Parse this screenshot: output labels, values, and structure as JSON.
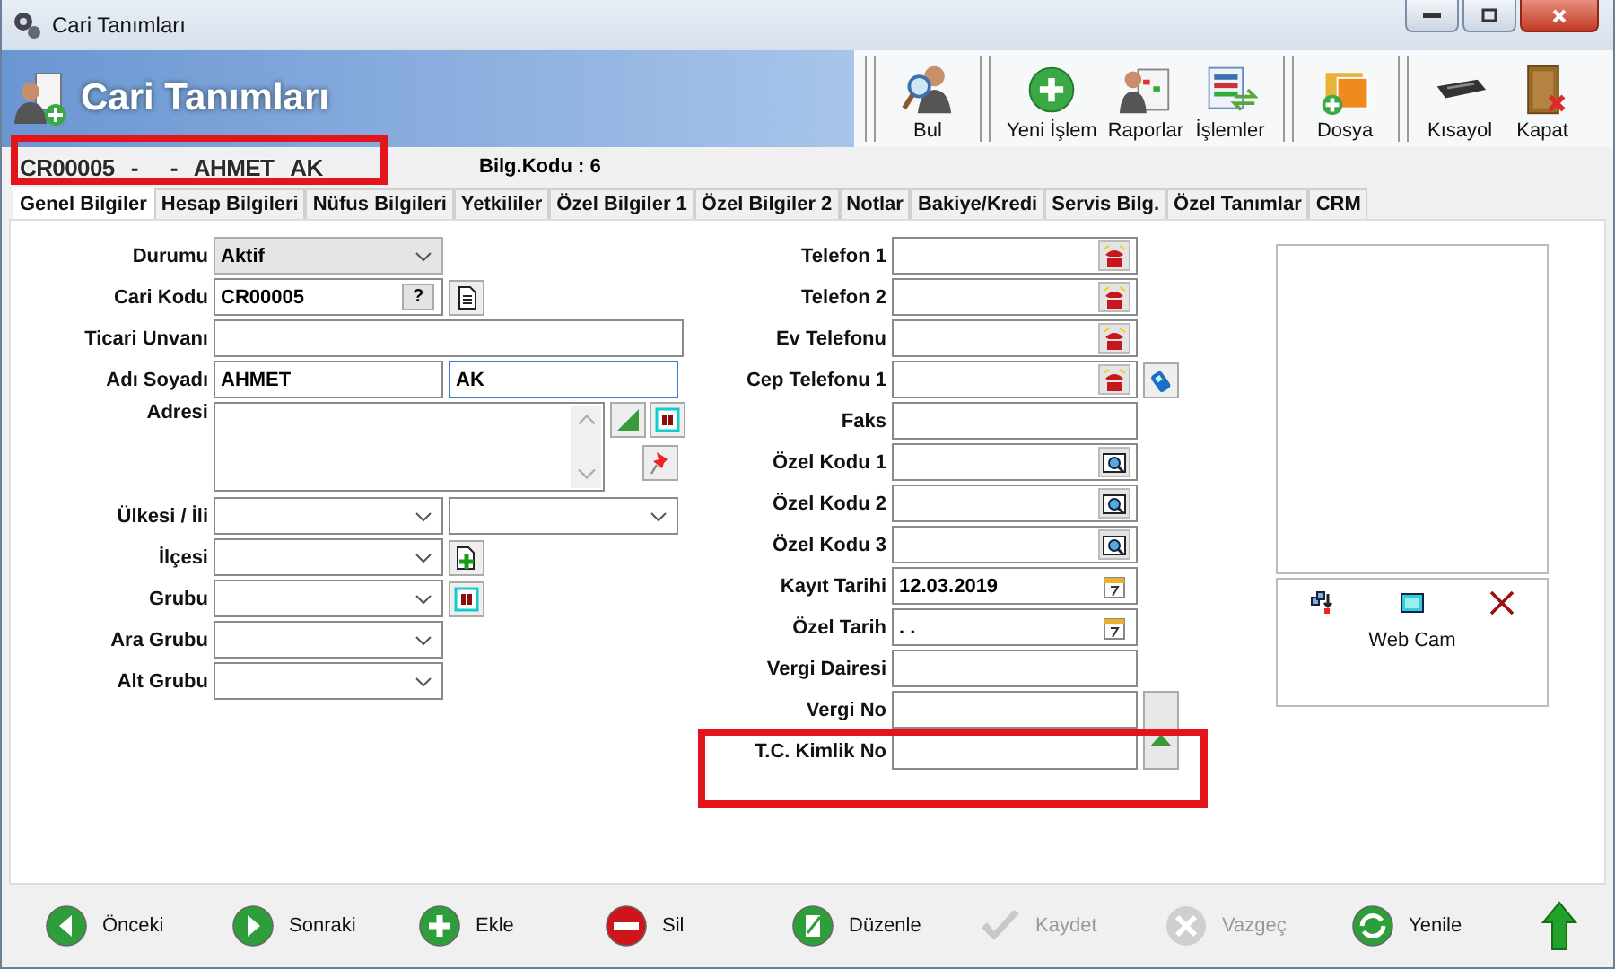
{
  "window": {
    "title": "Cari Tanımları"
  },
  "header": {
    "title": "Cari Tanımları"
  },
  "toolbar": [
    {
      "label": "Bul",
      "kind": "find"
    },
    {
      "label": "Yeni İşlem",
      "kind": "new"
    },
    {
      "label": "Raporlar",
      "kind": "reports"
    },
    {
      "label": "İşlemler",
      "kind": "operations"
    },
    {
      "label": "Dosya",
      "kind": "file"
    },
    {
      "label": "Kısayol",
      "kind": "shortcut"
    },
    {
      "label": "Kapat",
      "kind": "close"
    }
  ],
  "record_summary": [
    "CR00005",
    "-",
    "-",
    "AHMET",
    "AK"
  ],
  "bilg_kodu": "Bilg.Kodu : 6",
  "tabs": [
    {
      "label": "Genel Bilgiler",
      "selected": true
    },
    {
      "label": "Hesap Bilgileri",
      "selected": false
    },
    {
      "label": "Nüfus Bilgileri",
      "selected": false
    },
    {
      "label": "Yetkililer",
      "selected": false
    },
    {
      "label": "Özel Bilgiler 1",
      "selected": false
    },
    {
      "label": "Özel Bilgiler 2",
      "selected": false
    },
    {
      "label": "Notlar",
      "selected": false
    },
    {
      "label": "Bakiye/Kredi",
      "selected": false
    },
    {
      "label": "Servis Bilg.",
      "selected": false
    },
    {
      "label": "Özel Tanımlar",
      "selected": false
    },
    {
      "label": "CRM",
      "selected": false
    }
  ],
  "left_fields": [
    {
      "label": "Durumu",
      "kind": "status",
      "value": "Aktif"
    },
    {
      "label": "Cari Kodu",
      "kind": "lookup",
      "value": "CR00005",
      "button": "?"
    },
    {
      "label": "Ticari Unvanı",
      "kind": "text"
    },
    {
      "label": "Adı Soyadı",
      "kind": "pair",
      "values": [
        {
          "value": "AHMET",
          "focused": false
        },
        {
          "value": "AK",
          "focused": true
        }
      ]
    },
    {
      "label": "Adresi",
      "kind": "memo"
    },
    {
      "label": "Ülkesi / İli",
      "kind": "select_pair"
    },
    {
      "label": "İlçesi",
      "kind": "select_add"
    },
    {
      "label": "Grubu",
      "kind": "select_stop"
    },
    {
      "label": "Ara Grubu",
      "kind": "select"
    },
    {
      "label": "Alt Grubu",
      "kind": "select"
    }
  ],
  "middle_fields": [
    {
      "label": "Telefon 1",
      "kind": "phone"
    },
    {
      "label": "Telefon 2",
      "kind": "phone"
    },
    {
      "label": "Ev Telefonu",
      "kind": "phone"
    },
    {
      "label": "Cep Telefonu 1",
      "kind": "mobile"
    },
    {
      "label": "Faks",
      "kind": "text"
    },
    {
      "label": "Özel Kodu 1",
      "kind": "code"
    },
    {
      "label": "Özel Kodu 2",
      "kind": "code"
    },
    {
      "label": "Özel Kodu 3",
      "kind": "code"
    },
    {
      "label": "Kayıt Tarihi",
      "kind": "date",
      "value": "12.03.2019"
    },
    {
      "label": "Özel Tarih",
      "kind": "date",
      "value": ". ."
    },
    {
      "label": "Vergi Dairesi",
      "kind": "text"
    },
    {
      "label": "Vergi No",
      "kind": "tax"
    },
    {
      "label": "T.C. Kimlik No",
      "kind": "text"
    }
  ],
  "photo_panel": {
    "caption": "Web Cam"
  },
  "bottom_buttons": [
    {
      "label": "Önceki",
      "kind": "prev",
      "disabled": false
    },
    {
      "label": "Sonraki",
      "kind": "next",
      "disabled": false
    },
    {
      "label": "Ekle",
      "kind": "add",
      "disabled": false
    },
    {
      "label": "Sil",
      "kind": "delete",
      "disabled": false
    },
    {
      "label": "Düzenle",
      "kind": "edit",
      "disabled": false
    },
    {
      "label": "Kaydet",
      "kind": "save",
      "disabled": true
    },
    {
      "label": "Vazgeç",
      "kind": "cancel",
      "disabled": true
    },
    {
      "label": "Yenile",
      "kind": "refresh",
      "disabled": false
    }
  ]
}
